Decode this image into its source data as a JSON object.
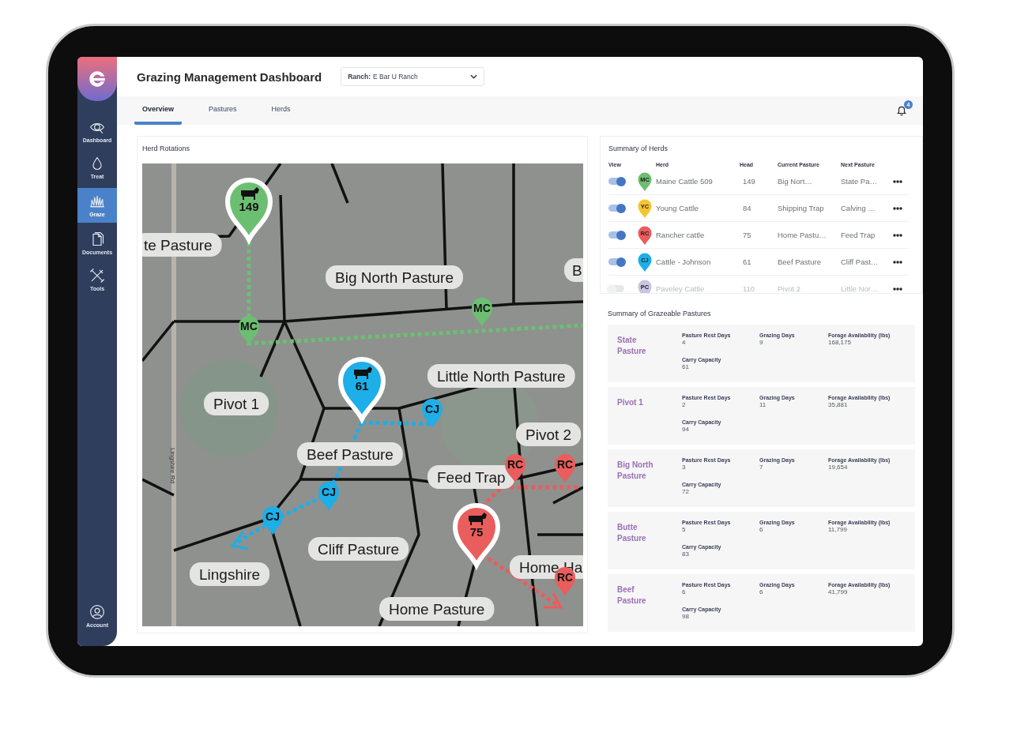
{
  "sidebar": {
    "items": [
      {
        "label": "Dashboard",
        "selected": false
      },
      {
        "label": "Treat",
        "selected": false
      },
      {
        "label": "Graze",
        "selected": true
      },
      {
        "label": "Documents",
        "selected": false
      },
      {
        "label": "Tools",
        "selected": false
      }
    ],
    "account": {
      "label": "Account"
    }
  },
  "header": {
    "title": "Grazing Management Dashboard",
    "ranch": {
      "label": "Ranch:",
      "value": "E Bar U Ranch"
    }
  },
  "tabs": [
    {
      "label": "Overview",
      "selected": true
    },
    {
      "label": "Pastures",
      "selected": false
    },
    {
      "label": "Herds",
      "selected": false
    }
  ],
  "notifications": {
    "count": "4"
  },
  "herd_rotations": {
    "title": "Herd Rotations",
    "map": {
      "road_label": "Lingshire Rd",
      "labels": [
        {
          "text": "te Pasture"
        },
        {
          "text": "Big North Pasture"
        },
        {
          "text": "B"
        },
        {
          "text": "Little North Pasture"
        },
        {
          "text": "Pivot 1"
        },
        {
          "text": "Pivot 2"
        },
        {
          "text": "Beef Pasture"
        },
        {
          "text": "Feed Trap"
        },
        {
          "text": "Cliff Pasture"
        },
        {
          "text": "Lingshire"
        },
        {
          "text": "Home Ha"
        },
        {
          "text": "Home Pasture"
        }
      ],
      "routes": [
        {
          "color": "#6cbf72"
        },
        {
          "color": "#1eaee8"
        },
        {
          "color": "#1eaee8"
        },
        {
          "color": "#ea5d5d"
        },
        {
          "color": "#ea5d5d"
        }
      ],
      "pins": [
        {
          "kind": "herd",
          "text": "149",
          "color": "#6cbf72"
        },
        {
          "kind": "marker",
          "text": "MC",
          "color": "#6cbf72"
        },
        {
          "kind": "marker",
          "text": "MC",
          "color": "#6cbf72"
        },
        {
          "kind": "marker",
          "text": "CJ",
          "color": "#1eaee8"
        },
        {
          "kind": "marker",
          "text": "CJ",
          "color": "#1eaee8"
        },
        {
          "kind": "marker",
          "text": "CJ",
          "color": "#1eaee8"
        },
        {
          "kind": "herd",
          "text": "61",
          "color": "#1eaee8"
        },
        {
          "kind": "marker",
          "text": "RC",
          "color": "#ea5d5d"
        },
        {
          "kind": "marker",
          "text": "RC",
          "color": "#ea5d5d"
        },
        {
          "kind": "marker",
          "text": "RC",
          "color": "#ea5d5d"
        },
        {
          "kind": "herd",
          "text": "75",
          "color": "#ea5d5d"
        }
      ]
    }
  },
  "herds": {
    "title": "Summary of Herds",
    "columns": [
      "View",
      "Herd",
      "Head",
      "Current Pasture",
      "Next Pasture"
    ],
    "rows": [
      {
        "view": true,
        "initials": "MC",
        "color": "#6cbf72",
        "herd": "Maine Cattle 509",
        "head": "149",
        "current": "Big Nort…",
        "next": "State Pa…"
      },
      {
        "view": true,
        "initials": "YC",
        "color": "#f6c531",
        "herd": "Young Cattle",
        "head": "84",
        "current": "Shipping Trap",
        "next": "Calving …"
      },
      {
        "view": true,
        "initials": "RC",
        "color": "#ea5d5d",
        "herd": "Rancher cattle",
        "head": "75",
        "current": "Home Pastu…",
        "next": "Feed Trap"
      },
      {
        "view": true,
        "initials": "CJ",
        "color": "#1eaee8",
        "herd": "Cattle - Johnson",
        "head": "61",
        "current": "Beef Pasture",
        "next": "Cliff Past…"
      },
      {
        "view": false,
        "initials": "PC",
        "color": "#c9c4e2",
        "herd": "Paveley Cattle",
        "head": "110",
        "current": "Pivot 2",
        "next": "Little Nor…"
      }
    ]
  },
  "pastures": {
    "title": "Summary of Grazeable Pastures",
    "cards": [
      {
        "name": "State Pasture",
        "fields": [
          {
            "label": "Pasture Rest Days",
            "value": "4"
          },
          {
            "label": "Grazing Days",
            "value": "9"
          },
          {
            "label": "Forage Availability (lbs)",
            "value": "168,175"
          },
          {
            "label": "Carry Capacity",
            "value": "61"
          }
        ]
      },
      {
        "name": "Pivot 1",
        "fields": [
          {
            "label": "Pasture Rest Days",
            "value": "2"
          },
          {
            "label": "Grazing Days",
            "value": "11"
          },
          {
            "label": "Forage Availability (lbs)",
            "value": "35,881"
          },
          {
            "label": "Carry Capacity",
            "value": "94"
          }
        ]
      },
      {
        "name": "Big North Pasture",
        "fields": [
          {
            "label": "Pasture Rest Days",
            "value": "3"
          },
          {
            "label": "Grazing Days",
            "value": "7"
          },
          {
            "label": "Forage Availability (lbs)",
            "value": "19,654"
          },
          {
            "label": "Carry Capacity",
            "value": "72"
          }
        ]
      },
      {
        "name": "Butte Pasture",
        "fields": [
          {
            "label": "Pasture Rest Days",
            "value": "5"
          },
          {
            "label": "Grazing Days",
            "value": "6"
          },
          {
            "label": "Forage Availability (lbs)",
            "value": "11,799"
          },
          {
            "label": "Carry Capacity",
            "value": "83"
          }
        ]
      },
      {
        "name": "Beef Pasture",
        "fields": [
          {
            "label": "Pasture Rest Days",
            "value": "6"
          },
          {
            "label": "Grazing Days",
            "value": "6"
          },
          {
            "label": "Forage Availability (lbs)",
            "value": "41,799"
          },
          {
            "label": "Carry Capacity",
            "value": "98"
          }
        ]
      }
    ]
  }
}
